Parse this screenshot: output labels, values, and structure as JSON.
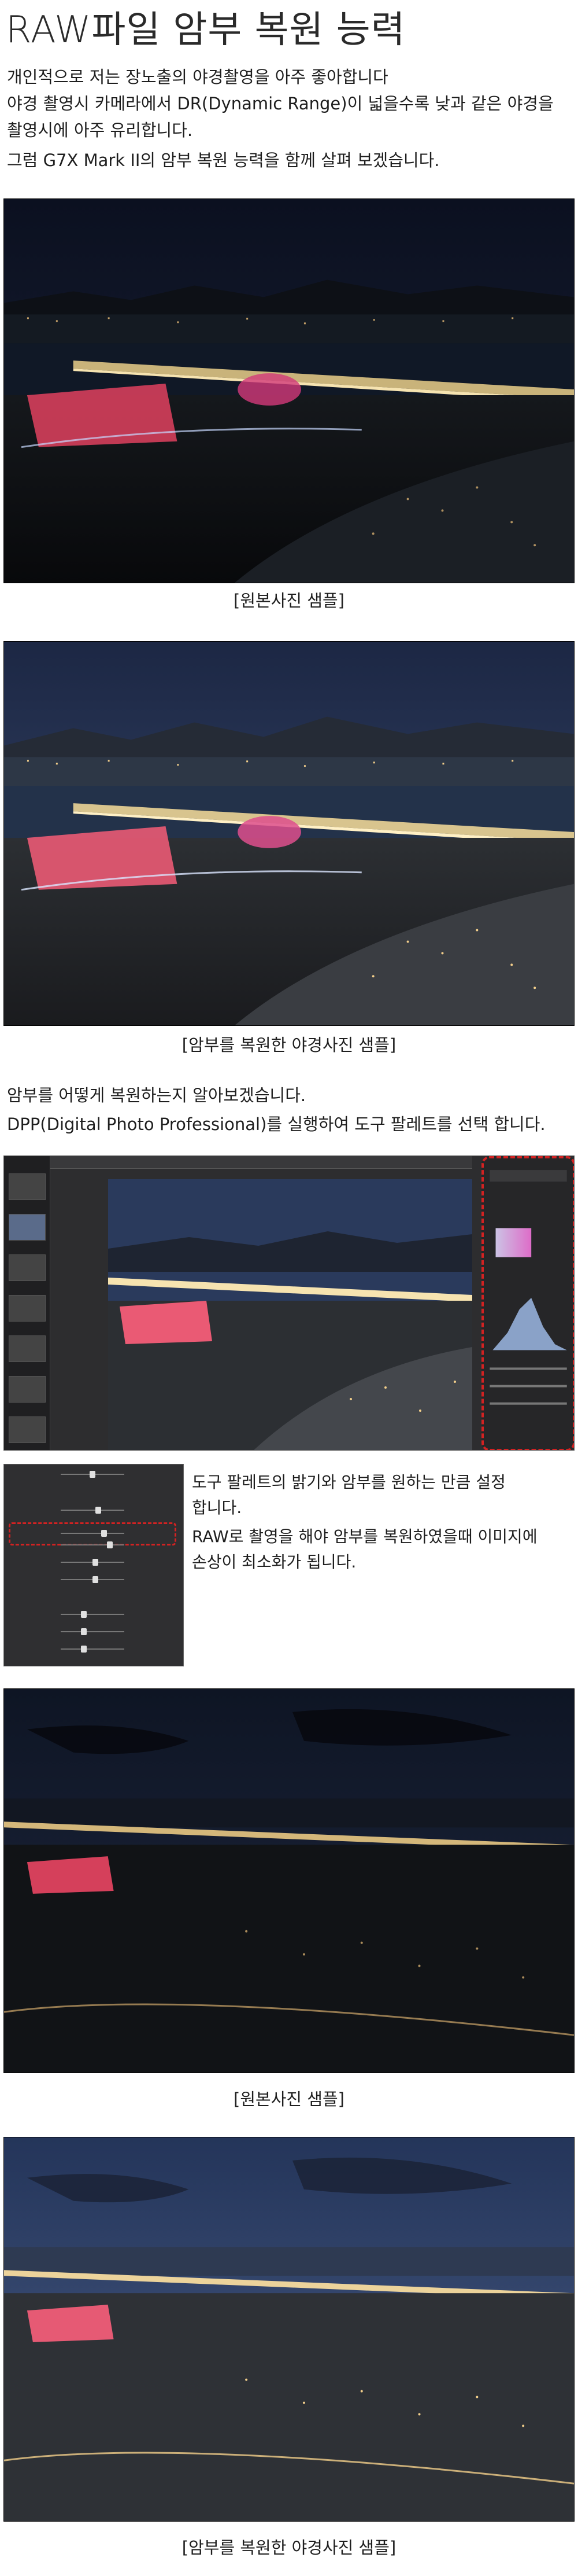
{
  "page": {
    "title": "RAW파일 암부 복원 능력",
    "intro": [
      "개인적으로 저는 장노출의 야경촬영을 아주 좋아합니다",
      "야경 촬영시 카메라에서 DR(Dynamic Range)이 넓을수록 낮과 같은 야경을",
      "촬영시에 아주 유리합니다.",
      "그럼 G7X Mark II의 암부 복원 능력을 함께 살펴 보겠습니다."
    ],
    "captions": {
      "original_1": "[원본사진 샘플]",
      "restored_1": "[암부를 복원한 야경사진 샘플]",
      "original_2": "[원본사진 샘플]",
      "restored_2": "[암부를 복원한 야경사진 샘플]"
    },
    "dpp_text": [
      "암부를 어떻게 복원하는지 알아보겠습니다.",
      "DPP(Digital Photo Professional)를 실행하여 도구 팔레트를 선택 합니다."
    ],
    "palette_text": [
      "도구 팔레트의 밝기와 암부를 원하는 만큼 설정",
      "합니다.",
      "RAW로 촬영을 해야 암부를 복원하였을때 이미지에",
      "손상이 최소화가 됩니다."
    ]
  },
  "colors": {
    "accent_red": "#d32222",
    "sky_dark": "#0c1221",
    "sky_blue": "#2a3a5c",
    "city_light": "#f0c27a",
    "pink_light": "#e0415f"
  }
}
